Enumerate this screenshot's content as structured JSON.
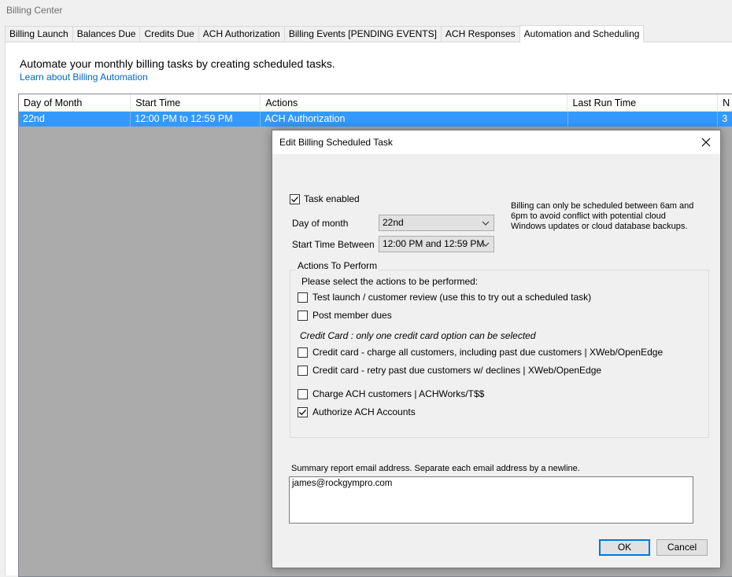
{
  "app": {
    "title": "Billing Center"
  },
  "tabs": [
    {
      "label": "Billing Launch"
    },
    {
      "label": "Balances Due"
    },
    {
      "label": "Credits Due"
    },
    {
      "label": "ACH Authorization"
    },
    {
      "label": "Billing Events [PENDING EVENTS]"
    },
    {
      "label": "ACH Responses"
    },
    {
      "label": "Automation and Scheduling"
    }
  ],
  "main": {
    "intro": "Automate your monthly billing tasks by creating scheduled tasks.",
    "learn_link": "Learn about Billing Automation"
  },
  "grid": {
    "columns": [
      "Day of Month",
      "Start Time",
      "Actions",
      "Last Run Time",
      "N"
    ],
    "rows": [
      {
        "day": "22nd",
        "start": "12:00 PM to 12:59 PM",
        "actions": "ACH Authorization",
        "last_run": "",
        "next": "3"
      }
    ]
  },
  "dialog": {
    "title": "Edit Billing Scheduled Task",
    "task_enabled": {
      "label": "Task enabled",
      "checked": true
    },
    "day_of_month": {
      "label": "Day of month",
      "value": "22nd"
    },
    "start_time": {
      "label": "Start Time Between",
      "value": "12:00 PM and 12:59 PM"
    },
    "note": "Billing can only be scheduled between 6am and 6pm to avoid conflict with potential cloud Windows updates or cloud database backups.",
    "actions_group": {
      "legend": "Actions To Perform",
      "instructions": "Please select the actions to be performed:",
      "credit_card_note": "Credit Card : only one credit card option can be selected",
      "options": [
        {
          "label": "Test launch / customer review (use this to try out a scheduled task)",
          "checked": false
        },
        {
          "label": "Post member dues",
          "checked": false
        },
        {
          "label": "Credit card - charge all customers, including past due customers | XWeb/OpenEdge",
          "checked": false
        },
        {
          "label": "Credit card - retry past due customers w/ declines | XWeb/OpenEdge",
          "checked": false
        },
        {
          "label": "Charge ACH customers | ACHWorks/T$$",
          "checked": false
        },
        {
          "label": "Authorize ACH Accounts",
          "checked": true
        }
      ]
    },
    "email": {
      "label": "Summary report email address.  Separate each email address by a newline.",
      "value": "james@rockgympro.com"
    },
    "ok_label": "OK",
    "cancel_label": "Cancel"
  },
  "colors": {
    "selection": "#3399ff",
    "link": "#0066cc",
    "default_button_border": "#0078d7"
  }
}
